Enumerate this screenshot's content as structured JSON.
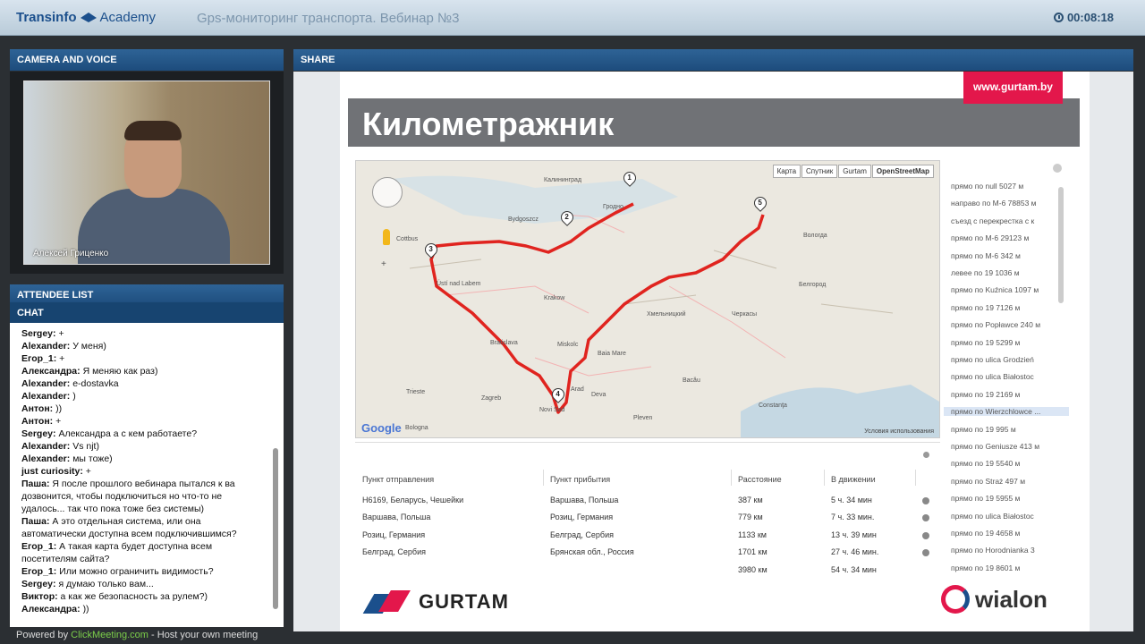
{
  "header": {
    "logo_part1": "Transinfo",
    "logo_part2": "Academy",
    "webinar_title": "Gps-мониторинг транспорта. Вебинар №3",
    "timer": "00:08:18"
  },
  "camera": {
    "heading": "CAMERA AND VOICE",
    "presenter_name": "Алексей Гриценко"
  },
  "attendee_list": {
    "heading": "ATTENDEE LIST"
  },
  "chat": {
    "heading": "CHAT",
    "messages": [
      {
        "author": "Sergey:",
        "text": "+"
      },
      {
        "author": "Alexander:",
        "text": "У меня)"
      },
      {
        "author": "Егор_1:",
        "text": "+"
      },
      {
        "author": "Александра:",
        "text": "Я меняю как раз)"
      },
      {
        "author": "Alexander:",
        "text": "e-dostavka"
      },
      {
        "author": "Alexander:",
        "text": ")"
      },
      {
        "author": "Антон:",
        "text": "))"
      },
      {
        "author": "Антон:",
        "text": "+"
      },
      {
        "author": "Sergey:",
        "text": "Александра а с кем работаете?"
      },
      {
        "author": "Alexander:",
        "text": "Vs njt)"
      },
      {
        "author": "Alexander:",
        "text": "мы тоже)"
      },
      {
        "author": "just curiosity:",
        "text": "+"
      },
      {
        "author": "Паша:",
        "text": "Я после прошлого вебинара пытался к ва"
      },
      {
        "author": "",
        "text": "дозвонится, чтобы подключиться но что-то не"
      },
      {
        "author": "",
        "text": "удалось... так что пока тоже без системы)"
      },
      {
        "author": "Паша:",
        "text": "А это отдельная система, или она"
      },
      {
        "author": "",
        "text": "автоматически доступна всем подключившимся?"
      },
      {
        "author": "Егор_1:",
        "text": "А такая карта будет доступна всем"
      },
      {
        "author": "",
        "text": "посетителям сайта?"
      },
      {
        "author": "Егор_1:",
        "text": "Или можно ограничить видимость?"
      },
      {
        "author": "Sergey:",
        "text": "я думаю только вам..."
      },
      {
        "author": "Виктор:",
        "text": "а как же безопасность за рулем?)"
      },
      {
        "author": "Александра:",
        "text": "))"
      }
    ]
  },
  "footer": {
    "powered_by": "Powered by",
    "link": "ClickMeeting.com",
    "suffix": "- Host your own meeting"
  },
  "share": {
    "heading": "SHARE",
    "url_badge": "www.gurtam.by",
    "slide_title": "Километражник",
    "map_types": [
      "Карта",
      "Спутник",
      "Gurtam",
      "OpenStreetMap"
    ],
    "map_labels": [
      "Калининград",
      "Гродно",
      "Bydgoszcz",
      "Cottbus",
      "Ústí nad Labem",
      "Krakow",
      "Bratislava",
      "Miskolc",
      "Baia Mare",
      "Arad",
      "Deva",
      "Zagreb",
      "Trieste",
      "Bologna",
      "Novi Sad",
      "Хмельницкий",
      "Черкасы",
      "Белгород",
      "Вологда",
      "Bacău",
      "Constanţa",
      "Pleven"
    ],
    "map_terms": "Условия использования",
    "google": "Google",
    "directions": [
      "прямо по null 5027 м",
      "направо по M-6 78853 м",
      "съезд с перекрестка с к",
      "прямо по M-6 29123 м",
      "прямо по M-6 342 м",
      "левее по 19 1036 м",
      "прямо по Kuźnica 1097 м",
      "прямо по 19 7126 м",
      "прямо по Popławce 240 м",
      "прямо по 19 5299 м",
      "прямо по ulica Grodzień",
      "прямо по ulica Białostoc",
      "прямо по 19 2169 м",
      "прямо по Wierzchlowce ...",
      "прямо по 19 995 м",
      "прямо по Geniusze 413 м",
      "прямо по 19 5540 м",
      "прямо по Straż 497 м",
      "прямо по 19 5955 м",
      "прямо по ulica Białostoc",
      "прямо по 19 4658 м",
      "прямо по Horodnianka 3",
      "прямо по 19 8601 м"
    ],
    "table": {
      "headers": [
        "Пункт отправления",
        "Пункт прибытия",
        "Расстояние",
        "В движении"
      ],
      "rows": [
        [
          "Н6169, Беларусь, Чешейки",
          "Варшава, Польша",
          "387 км",
          "5 ч. 34 мин"
        ],
        [
          "Варшава, Польша",
          "Розиц, Германия",
          "779 км",
          "7 ч. 33 мин."
        ],
        [
          "Розиц, Германия",
          "Белград, Сербия",
          "1133 км",
          "13 ч. 39 мин"
        ],
        [
          "Белград, Сербия",
          "Брянская обл., Россия",
          "1701 км",
          "27 ч. 46 мин."
        ],
        [
          "",
          "",
          "3980 км",
          "54 ч. 34 мин"
        ]
      ]
    },
    "logo_gurtam": "GURTAM",
    "logo_wialon": "wialon"
  },
  "colors": {
    "route": "#e0241f",
    "header_blue": "#1d4c7c",
    "brand_red": "#e3174b"
  }
}
